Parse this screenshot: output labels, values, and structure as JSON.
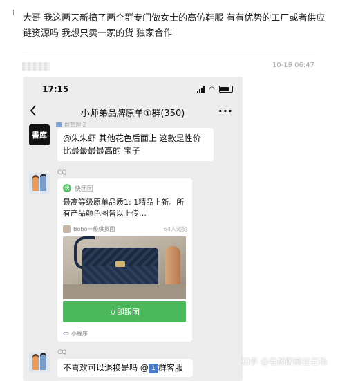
{
  "post": {
    "text": "大哥 我这两天新搞了两个群专门做女士的高仿鞋服  有有优势的工厂或者供应链资源吗  我想只卖一家的货 独家合作",
    "timestamp": "10-19 06:47"
  },
  "phone": {
    "status_time": "17:15",
    "chat_title": "小师弟品牌原单①群(350)",
    "more_label": "···",
    "messages": [
      {
        "avatar_text": "書库",
        "clipped_sender": "群管理 2",
        "text": "@朱朱虾 其他花色后面上 这款是性价比最最最最高的 宝子"
      },
      {
        "sender": "CQ",
        "card": {
          "source_logo": "快",
          "source": "快团团",
          "description": "最高等级原单品质1: 1精品上新。所有产品颜色图皆以上传…",
          "supplier": "Bobo一级供货团",
          "views": "64人浏览",
          "button": "立即跟团",
          "footer": "小程序"
        }
      },
      {
        "sender": "CQ",
        "text_before": "不喜欢可以退换是吗 @",
        "badge": "1",
        "text_after": "群客服"
      }
    ]
  },
  "watermark": "知乎 @老杨聊商社老杨"
}
